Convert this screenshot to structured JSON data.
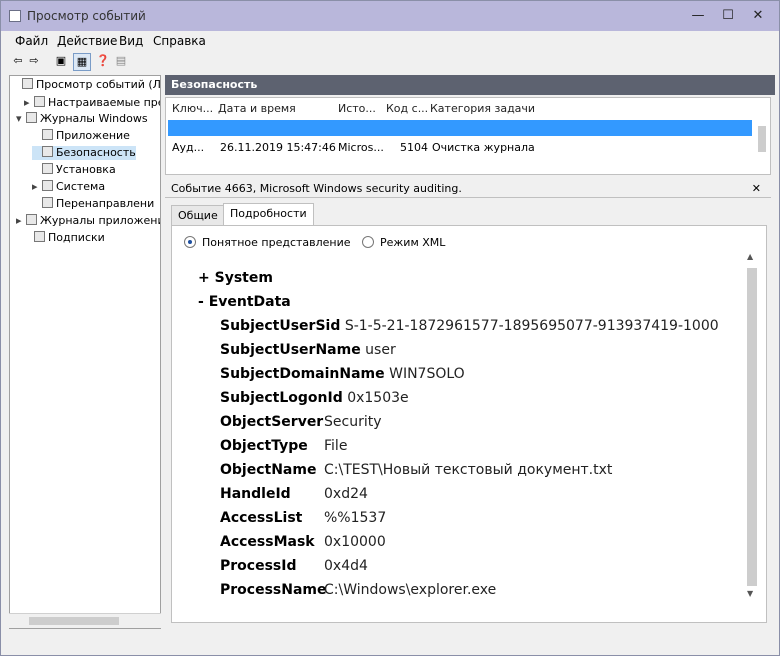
{
  "window": {
    "title": "Просмотр событий"
  },
  "controls": {
    "minimize": "—",
    "maximize": "☐",
    "close": "✕"
  },
  "menu": [
    "Файл",
    "Действие",
    "Вид",
    "Справка"
  ],
  "toolbar": {
    "back": "⇦",
    "forward": "⇨",
    "btn1": "▣",
    "btn2": "▦",
    "btn3": "❓",
    "btn4": "▤"
  },
  "tree": [
    {
      "label": "Просмотр событий (Лок",
      "exp": "",
      "indent": 0
    },
    {
      "label": "Настраиваемые предс",
      "exp": "▸",
      "indent": 1
    },
    {
      "label": "Журналы Windows",
      "exp": "▾",
      "indent": 1
    },
    {
      "label": "Приложение",
      "exp": "",
      "indent": 2
    },
    {
      "label": "Безопасность",
      "exp": "",
      "indent": 2
    },
    {
      "label": "Установка",
      "exp": "",
      "indent": 2
    },
    {
      "label": "Система",
      "exp": "▸",
      "indent": 2
    },
    {
      "label": "Перенаправлени",
      "exp": "",
      "indent": 2
    },
    {
      "label": "Журналы приложени",
      "exp": "▸",
      "indent": 1
    },
    {
      "label": "Подписки",
      "exp": "",
      "indent": 1
    }
  ],
  "events": {
    "header": "Безопасность",
    "header_sub": "",
    "columns": [
      "Ключ...",
      "Дата и время",
      "Исто...",
      "Код с...",
      "Категория задачи"
    ],
    "rows": [
      {
        "c1": "",
        "c2": "",
        "c3": "",
        "c4": "",
        "c5": "",
        "selected": true
      },
      {
        "c1": "Ауд...",
        "c2": "26.11.2019 15:47:46",
        "c3": "Micros...",
        "c4": "5104",
        "c5": "Очистка журнала",
        "selected": false
      }
    ]
  },
  "detail": {
    "header": "Событие 4663, Microsoft Windows security auditing.",
    "tabs": [
      "Общие",
      "Подробности"
    ],
    "radio_friendly": "Понятное представление",
    "radio_xml": "Режим XML",
    "system_label": "System",
    "eventdata_label": "EventData",
    "fields": [
      {
        "name": "SubjectUserSid",
        "value": "S-1-5-21-1872961577-1895695077-913937419-1000"
      },
      {
        "name": "SubjectUserName",
        "value": "user"
      },
      {
        "name": "SubjectDomainName",
        "value": "WIN7SOLO"
      },
      {
        "name": "SubjectLogonId",
        "value": "0x1503e"
      },
      {
        "name": "ObjectServer",
        "value": "Security"
      },
      {
        "name": "ObjectType",
        "value": "File"
      },
      {
        "name": "ObjectName",
        "value": "C:\\TEST\\Новый текстовый документ.txt"
      },
      {
        "name": "HandleId",
        "value": "0xd24"
      },
      {
        "name": "AccessList",
        "value": "%%1537"
      },
      {
        "name": "AccessMask",
        "value": "0x10000"
      },
      {
        "name": "ProcessId",
        "value": "0x4d4"
      },
      {
        "name": "ProcessName",
        "value": "C:\\Windows\\explorer.exe"
      }
    ]
  }
}
